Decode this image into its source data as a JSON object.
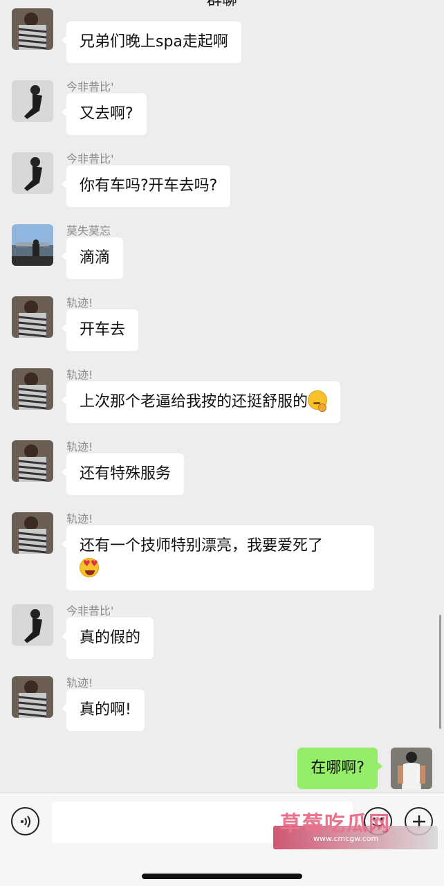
{
  "header": {
    "title": "群聊"
  },
  "messages": [
    {
      "sender": "轨迹!",
      "text": "兄弟们晚上spa走起啊",
      "avatar": "striped-shirt-man-avatar"
    },
    {
      "sender": "今非昔比'",
      "text": "又去啊?",
      "avatar": "dark-coat-man-avatar"
    },
    {
      "sender": "今非昔比'",
      "text": "你有车吗?开车去吗?",
      "avatar": "dark-coat-man-avatar"
    },
    {
      "sender": "莫失莫忘",
      "text": "滴滴",
      "avatar": "city-view-avatar"
    },
    {
      "sender": "轨迹!",
      "text": "开车去",
      "avatar": "striped-shirt-man-avatar"
    },
    {
      "sender": "轨迹!",
      "text": "上次那个老逼给我按的还挺舒服的",
      "emoji": "thinking-face",
      "avatar": "striped-shirt-man-avatar"
    },
    {
      "sender": "轨迹!",
      "text": "还有特殊服务",
      "avatar": "striped-shirt-man-avatar"
    },
    {
      "sender": "轨迹!",
      "text": "还有一个技师特别漂亮，我要爱死了",
      "emoji": "heart-eyes-face",
      "avatar": "striped-shirt-man-avatar"
    },
    {
      "sender": "今非昔比'",
      "text": "真的假的",
      "avatar": "dark-coat-man-avatar"
    },
    {
      "sender": "轨迹!",
      "text": "真的啊!",
      "avatar": "striped-shirt-man-avatar"
    }
  ],
  "my_message": {
    "text": "在哪啊?",
    "avatar": "white-tanktop-man-avatar"
  },
  "input_bar": {
    "voice_icon": "voice-icon",
    "input_value": "",
    "emoji_icon": "emoji-icon",
    "plus_icon": "plus-icon"
  },
  "watermark": {
    "title": "草莓吃瓜网",
    "url": "www.cmcgw.com"
  },
  "colors": {
    "background": "#ededed",
    "bubble_in": "#ffffff",
    "bubble_out": "#95ec69"
  }
}
